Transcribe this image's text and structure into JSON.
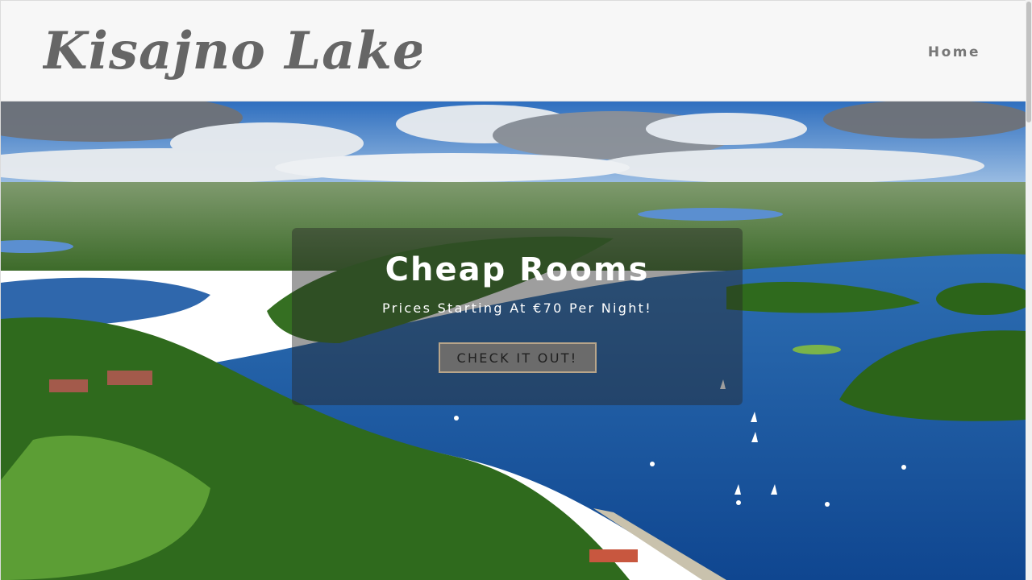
{
  "header": {
    "logo_text": "Kisajno Lake",
    "nav": {
      "home_label": "Home"
    }
  },
  "hero": {
    "title": "Cheap Rooms",
    "subtitle": "Prices Starting At €70 Per Night!",
    "cta_label": "CHECK IT OUT!"
  },
  "colors": {
    "header_bg": "#f7f7f7",
    "logo_text": "#666666",
    "nav_text": "#777777",
    "overlay": "rgba(40,40,40,0.45)",
    "cta_bg": "#6b6b6b",
    "cta_border": "#b8a58a",
    "lake": "#1f5aa8",
    "forest": "#2e6b1f",
    "sky": "#3a78c2"
  }
}
